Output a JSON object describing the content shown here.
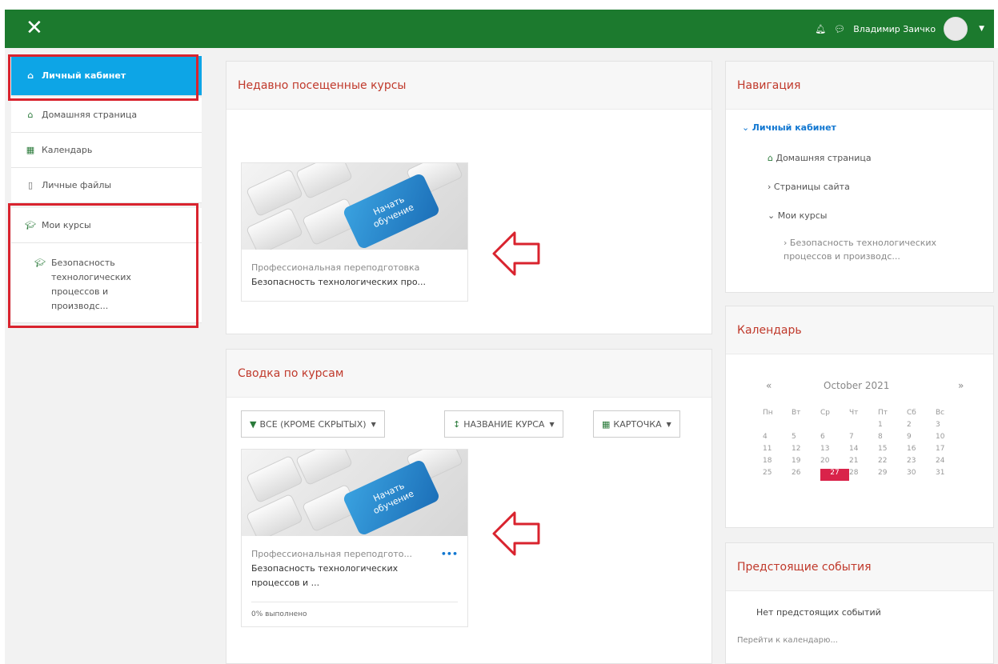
{
  "topbar": {
    "close_icon": "close-icon",
    "user_name": "Владимир Заичко",
    "bell_icon": "bell-icon",
    "chat_icon": "chat-icon"
  },
  "sidebar": {
    "items": [
      {
        "label": "Личный кабинет",
        "icon": "dashboard-icon"
      },
      {
        "label": "Домашняя страница",
        "icon": "home-icon"
      },
      {
        "label": "Календарь",
        "icon": "calendar-icon"
      },
      {
        "label": "Личные файлы",
        "icon": "file-icon"
      },
      {
        "label": "Мои курсы",
        "icon": "graduation-cap-icon"
      },
      {
        "label": "Безопасность технологических процессов и производс...",
        "icon": "graduation-cap-icon"
      }
    ]
  },
  "recent": {
    "title": "Недавно посещенные курсы",
    "course_image_text": [
      "Начать",
      "обучение"
    ],
    "category": "Профессиональная переподготовка",
    "name": "Безопасность технологических про..."
  },
  "overview": {
    "title": "Сводка по курсам",
    "filter_label": "ВСЕ (КРОМЕ СКРЫТЫХ)",
    "sort_label": "НАЗВАНИЕ КУРСА",
    "view_label": "КАРТОЧКА",
    "course_image_text": [
      "Начать",
      "обучение"
    ],
    "category": "Профессиональная переподгото...",
    "name": "Безопасность технологических процессов и ...",
    "progress": "0% выполнено"
  },
  "navigation": {
    "title": "Навигация",
    "root": "Личный кабинет",
    "home": "Домашняя страница",
    "site_pages": "Страницы сайта",
    "my_courses": "Мои курсы",
    "course": "Безопасность технологических процессов и производс..."
  },
  "calendar": {
    "title": "Календарь",
    "prev": "«",
    "next": "»",
    "month": "October 2021",
    "weekdays": [
      "Пн",
      "Вт",
      "Ср",
      "Чт",
      "Пт",
      "Сб",
      "Вс"
    ],
    "weeks": [
      [
        "",
        "",
        "",
        "",
        "1",
        "2",
        "3"
      ],
      [
        "4",
        "5",
        "6",
        "7",
        "8",
        "9",
        "10"
      ],
      [
        "11",
        "12",
        "13",
        "14",
        "15",
        "16",
        "17"
      ],
      [
        "18",
        "19",
        "20",
        "21",
        "22",
        "23",
        "24"
      ],
      [
        "25",
        "26",
        "27",
        "28",
        "29",
        "30",
        "31"
      ]
    ],
    "today": "27"
  },
  "events": {
    "title": "Предстоящие события",
    "empty": "Нет предстоящих событий",
    "link": "Перейти к календарю..."
  },
  "colors": {
    "topbar": "#1c7a2e",
    "active_item": "#0da5e6",
    "heading": "#c0392b",
    "highlight": "#d9232e"
  }
}
